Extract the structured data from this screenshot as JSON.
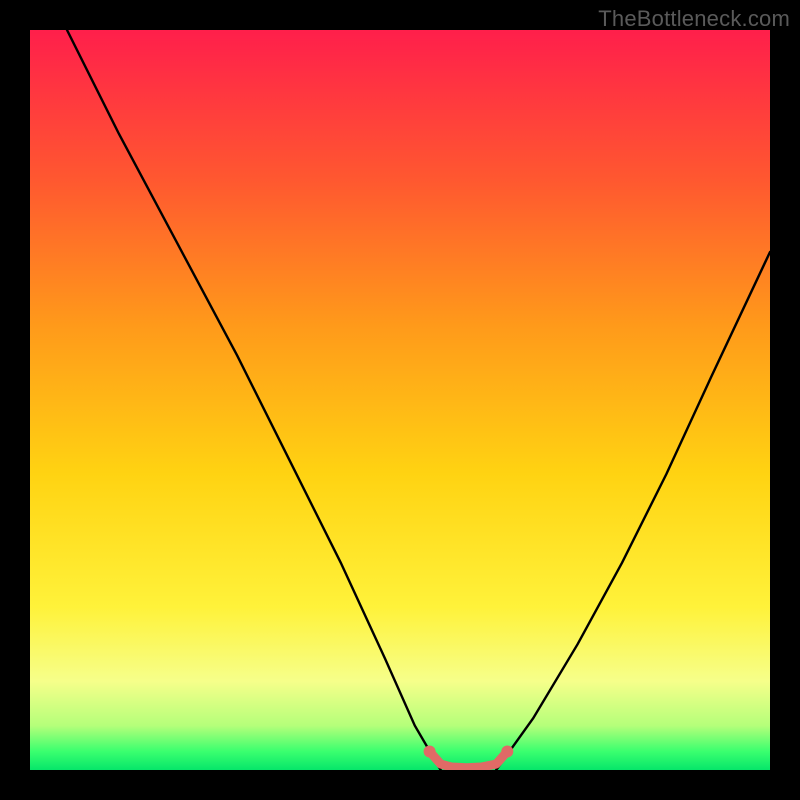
{
  "watermark": "TheBottleneck.com",
  "chart_data": {
    "type": "line",
    "title": "",
    "xlabel": "",
    "ylabel": "",
    "xlim": [
      0,
      100
    ],
    "ylim": [
      0,
      100
    ],
    "series": [
      {
        "name": "curve-left",
        "x": [
          5,
          12,
          20,
          28,
          35,
          42,
          48,
          52,
          55.5
        ],
        "values": [
          100,
          86,
          71,
          56,
          42,
          28,
          15,
          6,
          0
        ]
      },
      {
        "name": "curve-right",
        "x": [
          63,
          68,
          74,
          80,
          86,
          92,
          100
        ],
        "values": [
          0,
          7,
          17,
          28,
          40,
          53,
          70
        ]
      },
      {
        "name": "highlight-segment",
        "x": [
          54,
          55.5,
          57,
          59,
          61,
          63,
          64.5
        ],
        "values": [
          2.5,
          0.8,
          0.4,
          0.3,
          0.4,
          0.8,
          2.5
        ]
      }
    ],
    "background_gradient": {
      "stops": [
        {
          "offset": 0.0,
          "color": "#ff1f4b"
        },
        {
          "offset": 0.2,
          "color": "#ff5730"
        },
        {
          "offset": 0.4,
          "color": "#ff9a1a"
        },
        {
          "offset": 0.6,
          "color": "#ffd312"
        },
        {
          "offset": 0.78,
          "color": "#fff23a"
        },
        {
          "offset": 0.88,
          "color": "#f6ff8a"
        },
        {
          "offset": 0.94,
          "color": "#b5ff7a"
        },
        {
          "offset": 0.975,
          "color": "#3aff6f"
        },
        {
          "offset": 1.0,
          "color": "#06e66a"
        }
      ]
    },
    "colors": {
      "curve": "#000000",
      "highlight": "#e06a66",
      "frame": "#000000"
    }
  }
}
